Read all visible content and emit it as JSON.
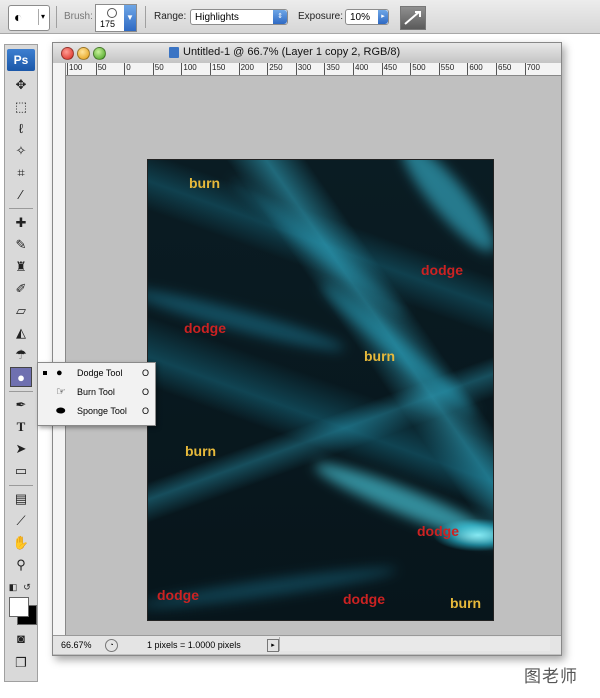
{
  "options_bar": {
    "tool_preset_glyph": "◐",
    "brush_label": "Brush:",
    "brush_size": "175",
    "range_label": "Range:",
    "range_value": "Highlights",
    "exposure_label": "Exposure:",
    "exposure_value": "10%"
  },
  "toolbox": {
    "logo": "Ps"
  },
  "flyout": {
    "items": [
      {
        "name": "Dodge Tool",
        "shortcut": "O",
        "icon": "dodge-icon",
        "selected": true
      },
      {
        "name": "Burn Tool",
        "shortcut": "O",
        "icon": "burn-icon",
        "selected": false
      },
      {
        "name": "Sponge Tool",
        "shortcut": "O",
        "icon": "sponge-icon",
        "selected": false
      }
    ]
  },
  "document": {
    "title": "Untitled-1 @ 66.7% (Layer 1 copy 2, RGB/8)",
    "ruler_labels": [
      "100",
      "50",
      "0",
      "50",
      "100",
      "150",
      "200",
      "250",
      "300",
      "350",
      "400",
      "450",
      "500",
      "550",
      "600",
      "650",
      "700"
    ],
    "status_zoom": "66.67%",
    "status_info": "1 pixels = 1.0000 pixels"
  },
  "canvas_labels": {
    "burn_1": "burn",
    "dodge_1": "dodge",
    "dodge_2": "dodge",
    "burn_2": "burn",
    "burn_3": "burn",
    "dodge_3": "dodge",
    "dodge_4": "dodge",
    "dodge_5": "dodge",
    "burn_4": "burn"
  },
  "colors": {
    "burn_label": "#e6b93b",
    "dodge_label": "#cc2222",
    "canvas_dark": "#07151b",
    "streak_cyan": "#2fc3e0"
  },
  "watermark": "图老师"
}
